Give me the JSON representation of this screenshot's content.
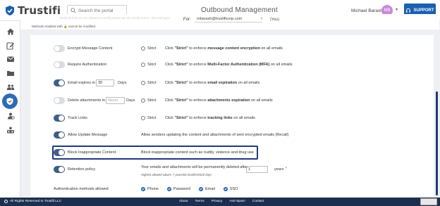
{
  "header": {
    "logo_text": "Trustifi",
    "search_placeholder": "Search the portal",
    "title": "Outbound Management",
    "user_name": "Michael Barash",
    "avatar_initials": "MB",
    "support_label": "SUPPORT",
    "accent": "#1b5fae"
  },
  "subheader": {
    "faded_note": "Methods that you are allowed to modify (users can not modify them) - all email types",
    "note": "Methods enabled with 🔒 cannot be modified.",
    "for_label": "For:",
    "for_value": "mbarash@trustificorp.com",
    "for_suffix": "(You)"
  },
  "sidebar": {
    "items": [
      "home-icon",
      "compose-icon",
      "mail-icon",
      "folder-icon",
      "contacts-icon",
      "shield-icon",
      "users-icon",
      "reports-icon"
    ],
    "active": "shield-icon"
  },
  "rows": {
    "encrypt": {
      "label": "Encrypt Message Content",
      "radio": "Strict",
      "desc_pre": "Click ",
      "desc_strict": "\"Strict\"",
      "desc_mid": " to enforce ",
      "desc_bold": "message content encryption",
      "desc_post": " on all emails",
      "enabled": false
    },
    "auth": {
      "label": "Require Authentication",
      "radio": "Strict",
      "desc_pre": "Click ",
      "desc_strict": "\"Strict\"",
      "desc_mid": " to enforce ",
      "desc_bold": "Multi-Factor Authentication (MFA)",
      "desc_post": " on all emails",
      "enabled": false
    },
    "expires": {
      "label": "Email expires in",
      "value": "30",
      "unit": "Days",
      "radio": "Strict",
      "desc_pre": "Click ",
      "desc_strict": "\"Strict\"",
      "desc_mid": " to enforce ",
      "desc_bold": "email expiration",
      "desc_post": " on all emails",
      "enabled": true
    },
    "delete_attachments": {
      "label": "Delete attachments in",
      "placeholder": "Never",
      "unit": "Days",
      "radio": "Strict",
      "desc_pre": "Click ",
      "desc_strict": "\"Strict\"",
      "desc_mid": " to enforce ",
      "desc_bold": "attachments expiration",
      "desc_post": " on all emails",
      "enabled": false
    },
    "track_links": {
      "label": "Track Links",
      "radio": "Strict",
      "desc_pre": "Click ",
      "desc_strict": "\"Strict\"",
      "desc_mid": " to enforce ",
      "desc_bold": "tracking links",
      "desc_post": " on all emails",
      "enabled": true
    },
    "allow_update": {
      "label": "Allow Update Message",
      "desc": "Allow senders updating the content and attachments of sent encrypted emails (Recall)",
      "enabled": true
    },
    "block_inappropriate": {
      "label": "Block Inappropriate Content",
      "desc": "Block inappropriate content such as nudity, violence and drug use",
      "enabled": true
    },
    "retention": {
      "label": "Retention policy",
      "desc": "Your emails and attachments will be permanently deleted after",
      "value": "1",
      "unit": "years",
      "hint": "Highest allowed values: 7 years/84 months/2520 days",
      "enabled": true
    }
  },
  "auth_methods": {
    "label": "Authentication methods allowed",
    "options": [
      "Phone",
      "Password",
      "Email",
      "SSO"
    ]
  },
  "footer": {
    "copyright": "All Rights Reserved to Trustifi LLC",
    "links": [
      "About",
      "Terms",
      "Privacy",
      "Anti-Spam",
      "Contact"
    ]
  }
}
